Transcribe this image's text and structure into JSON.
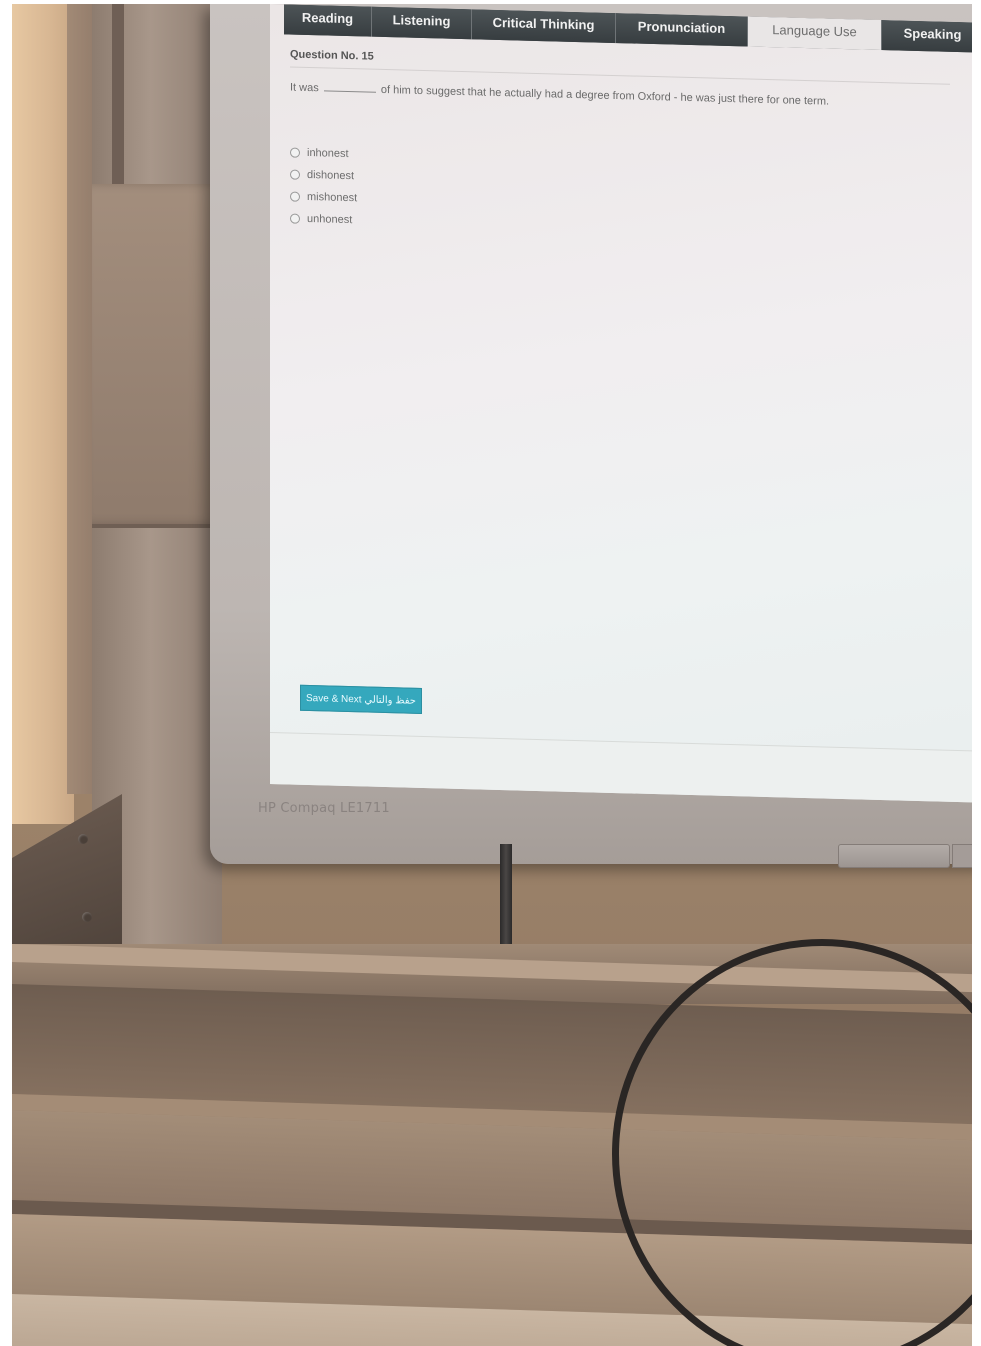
{
  "tabs": [
    {
      "label": "Reading",
      "active": false
    },
    {
      "label": "Listening",
      "active": false
    },
    {
      "label": "Critical Thinking",
      "active": false
    },
    {
      "label": "Pronunciation",
      "active": false
    },
    {
      "label": "Language Use",
      "active": true
    },
    {
      "label": "Speaking",
      "active": false
    }
  ],
  "question": {
    "header": "Question No. 15",
    "text_before": "It was",
    "text_after": "of him to suggest that he actually had a degree from Oxford - he was just there for one term.",
    "options": [
      "inhonest",
      "dishonest",
      "mishonest",
      "unhonest"
    ],
    "selected": null
  },
  "actions": {
    "save_next_label": "Save & Next حفظ والتالي"
  },
  "monitor": {
    "brand": "HP Compaq LE1711"
  },
  "colors": {
    "tab_bg": "#3d4346",
    "tab_active_bg": "#e9e6e6",
    "button_accent": "#35a8bd"
  }
}
